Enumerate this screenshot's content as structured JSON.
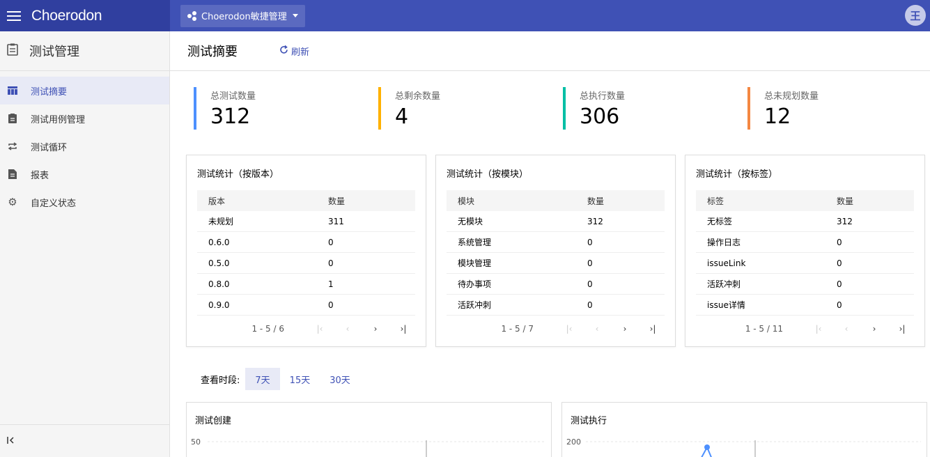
{
  "header": {
    "brand": "Choerodon",
    "project": "Choerodon敏捷管理",
    "avatar_text": "王",
    "colors": {
      "bar": "#3f51b5",
      "brand_bg": "#303f9f"
    }
  },
  "sidebar": {
    "title": "测试管理",
    "items": [
      {
        "label": "测试摘要",
        "icon": "table-icon",
        "active": true
      },
      {
        "label": "测试用例管理",
        "icon": "clipboard-icon",
        "active": false
      },
      {
        "label": "测试循环",
        "icon": "repeat-icon",
        "active": false
      },
      {
        "label": "报表",
        "icon": "document-icon",
        "active": false
      },
      {
        "label": "自定义状态",
        "icon": "gear-icon",
        "active": false
      }
    ],
    "collapse_icon": "collapse-left-icon"
  },
  "page": {
    "title": "测试摘要",
    "refresh_label": "刷新"
  },
  "stats": [
    {
      "label": "总测试数量",
      "value": "312",
      "color": "#4d90fe"
    },
    {
      "label": "总剩余数量",
      "value": "4",
      "color": "#ffb100"
    },
    {
      "label": "总执行数量",
      "value": "306",
      "color": "#00bfa5"
    },
    {
      "label": "总未规划数量",
      "value": "12",
      "color": "#f48742"
    }
  ],
  "cards": [
    {
      "title": "测试统计（按版本）",
      "columns": [
        "版本",
        "数量"
      ],
      "rows": [
        [
          "未规划",
          "311"
        ],
        [
          "0.6.0",
          "0"
        ],
        [
          "0.5.0",
          "0"
        ],
        [
          "0.8.0",
          "1"
        ],
        [
          "0.9.0",
          "0"
        ]
      ],
      "pager": "1 - 5 / 6"
    },
    {
      "title": "测试统计（按模块）",
      "columns": [
        "模块",
        "数量"
      ],
      "rows": [
        [
          "无模块",
          "312"
        ],
        [
          "系统管理",
          "0"
        ],
        [
          "模块管理",
          "0"
        ],
        [
          "待办事项",
          "0"
        ],
        [
          "活跃冲刺",
          "0"
        ]
      ],
      "pager": "1 - 5 / 7"
    },
    {
      "title": "测试统计（按标签）",
      "columns": [
        "标签",
        "数量"
      ],
      "rows": [
        [
          "无标签",
          "312"
        ],
        [
          "操作日志",
          "0"
        ],
        [
          "issueLink",
          "0"
        ],
        [
          "活跃冲刺",
          "0"
        ],
        [
          "issue详情",
          "0"
        ]
      ],
      "pager": "1 - 5 / 11"
    }
  ],
  "period": {
    "label": "查看时段:",
    "options": [
      "7天",
      "15天",
      "30天"
    ],
    "selected": "7天"
  },
  "charts": [
    {
      "title": "测试创建",
      "y_top_label": "50"
    },
    {
      "title": "测试执行",
      "y_top_label": "200"
    }
  ]
}
